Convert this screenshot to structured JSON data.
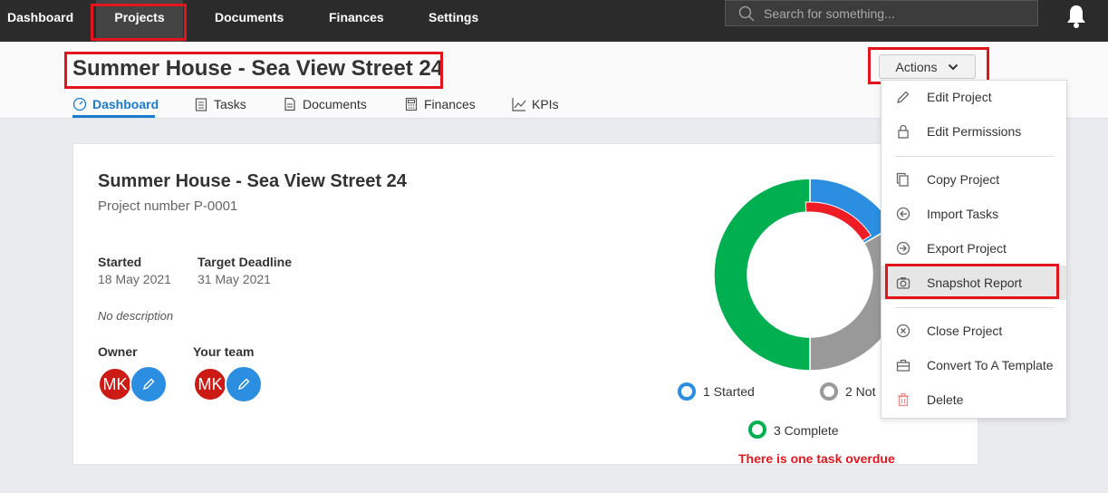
{
  "topnav": {
    "items": [
      {
        "label": "Dashboard"
      },
      {
        "label": "Projects"
      },
      {
        "label": "Documents"
      },
      {
        "label": "Finances"
      },
      {
        "label": "Settings"
      }
    ],
    "active": "Projects",
    "search_placeholder": "Search for something...",
    "icons": {
      "search": "search-icon",
      "notifications": "bell-icon"
    }
  },
  "header": {
    "title": "Summer House - Sea View Street 24",
    "actions_label": "Actions",
    "tabs": [
      {
        "label": "Dashboard",
        "icon": "gauge-icon"
      },
      {
        "label": "Tasks",
        "icon": "clipboard-icon"
      },
      {
        "label": "Documents",
        "icon": "document-icon"
      },
      {
        "label": "Finances",
        "icon": "calculator-icon"
      },
      {
        "label": "KPIs",
        "icon": "line-chart-icon"
      }
    ],
    "active_tab": "Dashboard"
  },
  "project": {
    "title": "Summer House - Sea View Street 24",
    "number": "Project number P-0001",
    "started_label": "Started",
    "started_value": "18 May 2021",
    "deadline_label": "Target Deadline",
    "deadline_value": "31 May 2021",
    "description": "No description",
    "owner_label": "Owner",
    "team_label": "Your team",
    "avatar_initials": "MK"
  },
  "chart": {
    "legend": [
      {
        "label": "1 Started",
        "color": "#2c8ee0"
      },
      {
        "label": "2 Not",
        "color": "#999999"
      },
      {
        "label": "3 Complete",
        "color": "#00b050"
      }
    ],
    "overdue_text": "There is one task overdue",
    "colors": {
      "started": "#2c8ee0",
      "not_started": "#999999",
      "complete": "#00b050",
      "overdue": "#ee1c25"
    }
  },
  "chart_data": {
    "type": "pie",
    "categories": [
      "Started",
      "Not started",
      "Complete"
    ],
    "values": [
      1,
      2,
      3
    ]
  },
  "actions_menu": {
    "items": [
      {
        "label": "Edit Project",
        "icon": "pencil-icon"
      },
      {
        "label": "Edit Permissions",
        "icon": "lock-icon"
      },
      {
        "label": "Copy Project",
        "icon": "copy-icon"
      },
      {
        "label": "Import Tasks",
        "icon": "import-icon"
      },
      {
        "label": "Export Project",
        "icon": "export-icon"
      },
      {
        "label": "Snapshot Report",
        "icon": "camera-icon"
      },
      {
        "label": "Close Project",
        "icon": "close-circle-icon"
      },
      {
        "label": "Convert To A Template",
        "icon": "briefcase-icon"
      },
      {
        "label": "Delete",
        "icon": "trash-icon"
      }
    ],
    "highlighted": "Snapshot Report"
  },
  "annotation_color": "#e3141b"
}
